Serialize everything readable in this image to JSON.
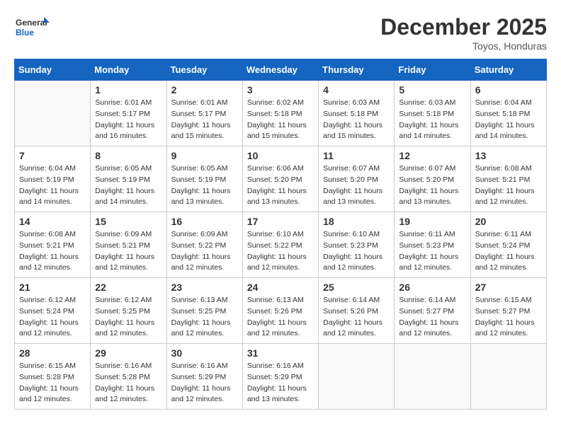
{
  "logo": {
    "text_general": "General",
    "text_blue": "Blue"
  },
  "title": "December 2025",
  "location": "Toyos, Honduras",
  "weekdays": [
    "Sunday",
    "Monday",
    "Tuesday",
    "Wednesday",
    "Thursday",
    "Friday",
    "Saturday"
  ],
  "weeks": [
    [
      {
        "day": "",
        "sunrise": "",
        "sunset": "",
        "daylight": ""
      },
      {
        "day": "1",
        "sunrise": "6:01 AM",
        "sunset": "5:17 PM",
        "daylight": "11 hours and 16 minutes."
      },
      {
        "day": "2",
        "sunrise": "6:01 AM",
        "sunset": "5:17 PM",
        "daylight": "11 hours and 15 minutes."
      },
      {
        "day": "3",
        "sunrise": "6:02 AM",
        "sunset": "5:18 PM",
        "daylight": "11 hours and 15 minutes."
      },
      {
        "day": "4",
        "sunrise": "6:03 AM",
        "sunset": "5:18 PM",
        "daylight": "11 hours and 15 minutes."
      },
      {
        "day": "5",
        "sunrise": "6:03 AM",
        "sunset": "5:18 PM",
        "daylight": "11 hours and 14 minutes."
      },
      {
        "day": "6",
        "sunrise": "6:04 AM",
        "sunset": "5:18 PM",
        "daylight": "11 hours and 14 minutes."
      }
    ],
    [
      {
        "day": "7",
        "sunrise": "6:04 AM",
        "sunset": "5:19 PM",
        "daylight": "11 hours and 14 minutes."
      },
      {
        "day": "8",
        "sunrise": "6:05 AM",
        "sunset": "5:19 PM",
        "daylight": "11 hours and 14 minutes."
      },
      {
        "day": "9",
        "sunrise": "6:05 AM",
        "sunset": "5:19 PM",
        "daylight": "11 hours and 13 minutes."
      },
      {
        "day": "10",
        "sunrise": "6:06 AM",
        "sunset": "5:20 PM",
        "daylight": "11 hours and 13 minutes."
      },
      {
        "day": "11",
        "sunrise": "6:07 AM",
        "sunset": "5:20 PM",
        "daylight": "11 hours and 13 minutes."
      },
      {
        "day": "12",
        "sunrise": "6:07 AM",
        "sunset": "5:20 PM",
        "daylight": "11 hours and 13 minutes."
      },
      {
        "day": "13",
        "sunrise": "6:08 AM",
        "sunset": "5:21 PM",
        "daylight": "11 hours and 12 minutes."
      }
    ],
    [
      {
        "day": "14",
        "sunrise": "6:08 AM",
        "sunset": "5:21 PM",
        "daylight": "11 hours and 12 minutes."
      },
      {
        "day": "15",
        "sunrise": "6:09 AM",
        "sunset": "5:21 PM",
        "daylight": "11 hours and 12 minutes."
      },
      {
        "day": "16",
        "sunrise": "6:09 AM",
        "sunset": "5:22 PM",
        "daylight": "11 hours and 12 minutes."
      },
      {
        "day": "17",
        "sunrise": "6:10 AM",
        "sunset": "5:22 PM",
        "daylight": "11 hours and 12 minutes."
      },
      {
        "day": "18",
        "sunrise": "6:10 AM",
        "sunset": "5:23 PM",
        "daylight": "11 hours and 12 minutes."
      },
      {
        "day": "19",
        "sunrise": "6:11 AM",
        "sunset": "5:23 PM",
        "daylight": "11 hours and 12 minutes."
      },
      {
        "day": "20",
        "sunrise": "6:11 AM",
        "sunset": "5:24 PM",
        "daylight": "11 hours and 12 minutes."
      }
    ],
    [
      {
        "day": "21",
        "sunrise": "6:12 AM",
        "sunset": "5:24 PM",
        "daylight": "11 hours and 12 minutes."
      },
      {
        "day": "22",
        "sunrise": "6:12 AM",
        "sunset": "5:25 PM",
        "daylight": "11 hours and 12 minutes."
      },
      {
        "day": "23",
        "sunrise": "6:13 AM",
        "sunset": "5:25 PM",
        "daylight": "11 hours and 12 minutes."
      },
      {
        "day": "24",
        "sunrise": "6:13 AM",
        "sunset": "5:26 PM",
        "daylight": "11 hours and 12 minutes."
      },
      {
        "day": "25",
        "sunrise": "6:14 AM",
        "sunset": "5:26 PM",
        "daylight": "11 hours and 12 minutes."
      },
      {
        "day": "26",
        "sunrise": "6:14 AM",
        "sunset": "5:27 PM",
        "daylight": "11 hours and 12 minutes."
      },
      {
        "day": "27",
        "sunrise": "6:15 AM",
        "sunset": "5:27 PM",
        "daylight": "11 hours and 12 minutes."
      }
    ],
    [
      {
        "day": "28",
        "sunrise": "6:15 AM",
        "sunset": "5:28 PM",
        "daylight": "11 hours and 12 minutes."
      },
      {
        "day": "29",
        "sunrise": "6:16 AM",
        "sunset": "5:28 PM",
        "daylight": "11 hours and 12 minutes."
      },
      {
        "day": "30",
        "sunrise": "6:16 AM",
        "sunset": "5:29 PM",
        "daylight": "11 hours and 12 minutes."
      },
      {
        "day": "31",
        "sunrise": "6:16 AM",
        "sunset": "5:29 PM",
        "daylight": "11 hours and 13 minutes."
      },
      {
        "day": "",
        "sunrise": "",
        "sunset": "",
        "daylight": ""
      },
      {
        "day": "",
        "sunrise": "",
        "sunset": "",
        "daylight": ""
      },
      {
        "day": "",
        "sunrise": "",
        "sunset": "",
        "daylight": ""
      }
    ]
  ]
}
